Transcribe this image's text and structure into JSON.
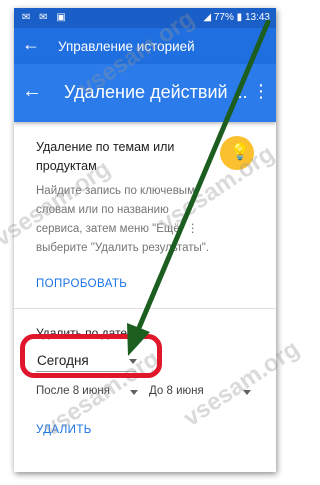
{
  "status_bar": {
    "battery": "77%",
    "time": "13:43"
  },
  "app_bar_top": {
    "title": "Управление историей",
    "back_icon": "arrow-back-icon"
  },
  "app_bar_main": {
    "title": "Удаление действий ...",
    "back_icon": "arrow-back-icon",
    "more_icon": "more-vert-icon"
  },
  "topics": {
    "title": "Удаление по темам или продуктам",
    "description": "Найдите запись по ключевым словам или по названию сервиса, затем меню \"Ещё\" ⋮ выберите \"Удалить результаты\".",
    "try_label": "ПОПРОБОВАТЬ",
    "icon": "lightbulb-icon"
  },
  "by_date": {
    "label": "Удалить по дате",
    "selected_value": "Сегодня",
    "after_label": "После 8 июня",
    "before_label": "До 8 июня",
    "delete_label": "УДАЛИТЬ"
  },
  "watermark": {
    "text": "vsesam.org"
  },
  "colors": {
    "status_bar": "#1a5fc8",
    "app_bar_top": "#1f6fe0",
    "app_bar_main": "#2b7bea",
    "accent_link": "#1a73e8",
    "bulb": "#fbc02d",
    "highlight_ring": "#e0162b",
    "arrow": "#1b5e20"
  }
}
